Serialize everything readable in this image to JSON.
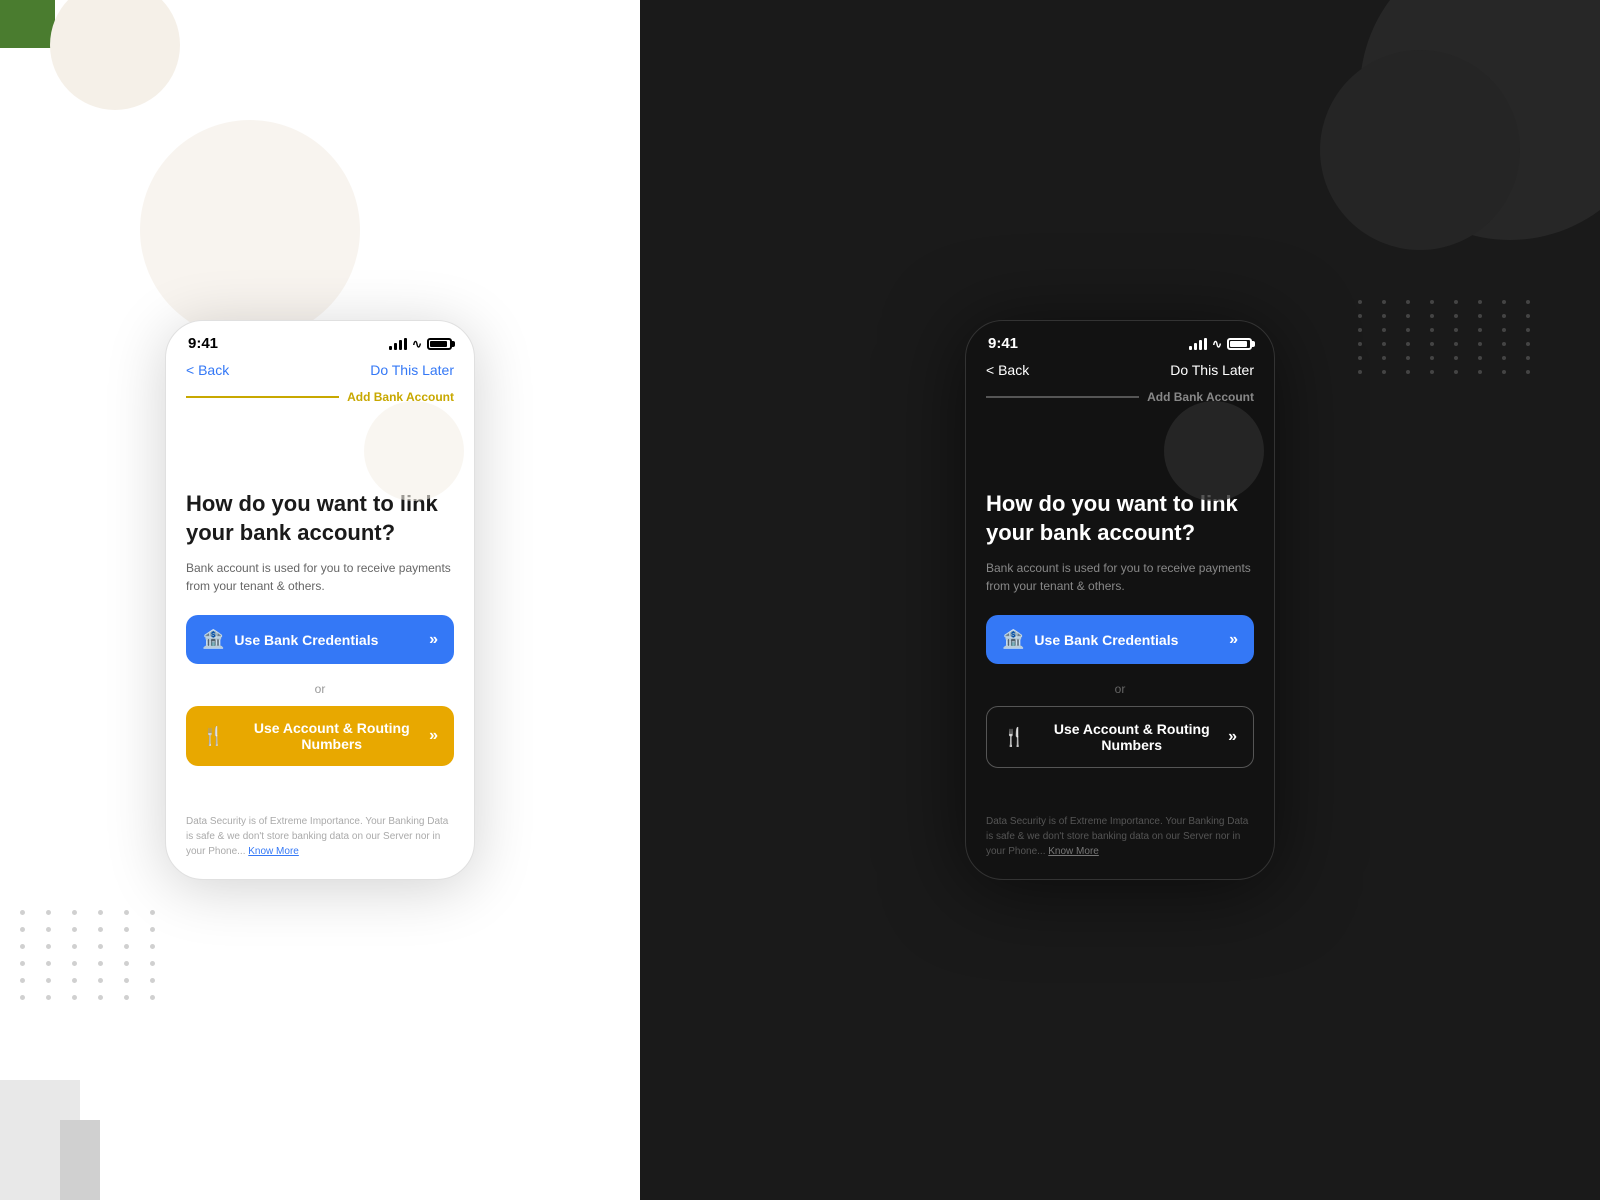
{
  "leftPanel": {
    "background": "#ffffff"
  },
  "rightPanel": {
    "background": "#1a1a1a"
  },
  "lightPhone": {
    "statusBar": {
      "time": "9:41"
    },
    "nav": {
      "back": "< Back",
      "doLater": "Do This Later"
    },
    "sectionTitle": "Add Bank Account",
    "heading": "How do you want to link your bank account?",
    "subText": "Bank account is used for you to receive payments from your tenant & others.",
    "bankCredentialsBtn": "Use Bank Credentials",
    "orDivider": "or",
    "routingBtn": "Use Account & Routing Numbers",
    "footerText": "Data Security is of Extreme Importance. Your Banking Data is safe & we don't store  banking data on our Server nor in your Phone...",
    "knowMore": "Know More"
  },
  "darkPhone": {
    "statusBar": {
      "time": "9:41"
    },
    "nav": {
      "back": "< Back",
      "doLater": "Do This Later"
    },
    "sectionTitle": "Add Bank Account",
    "heading": "How do you want to link your bank account?",
    "subText": "Bank account is used for you to receive payments from your tenant & others.",
    "bankCredentialsBtn": "Use Bank Credentials",
    "orDivider": "or",
    "routingBtn": "Use Account & Routing Numbers",
    "footerText": "Data Security is of Extreme Importance. Your Banking Data is safe & we don't store  banking data on our Server nor in your Phone...",
    "knowMore": "Know More"
  }
}
